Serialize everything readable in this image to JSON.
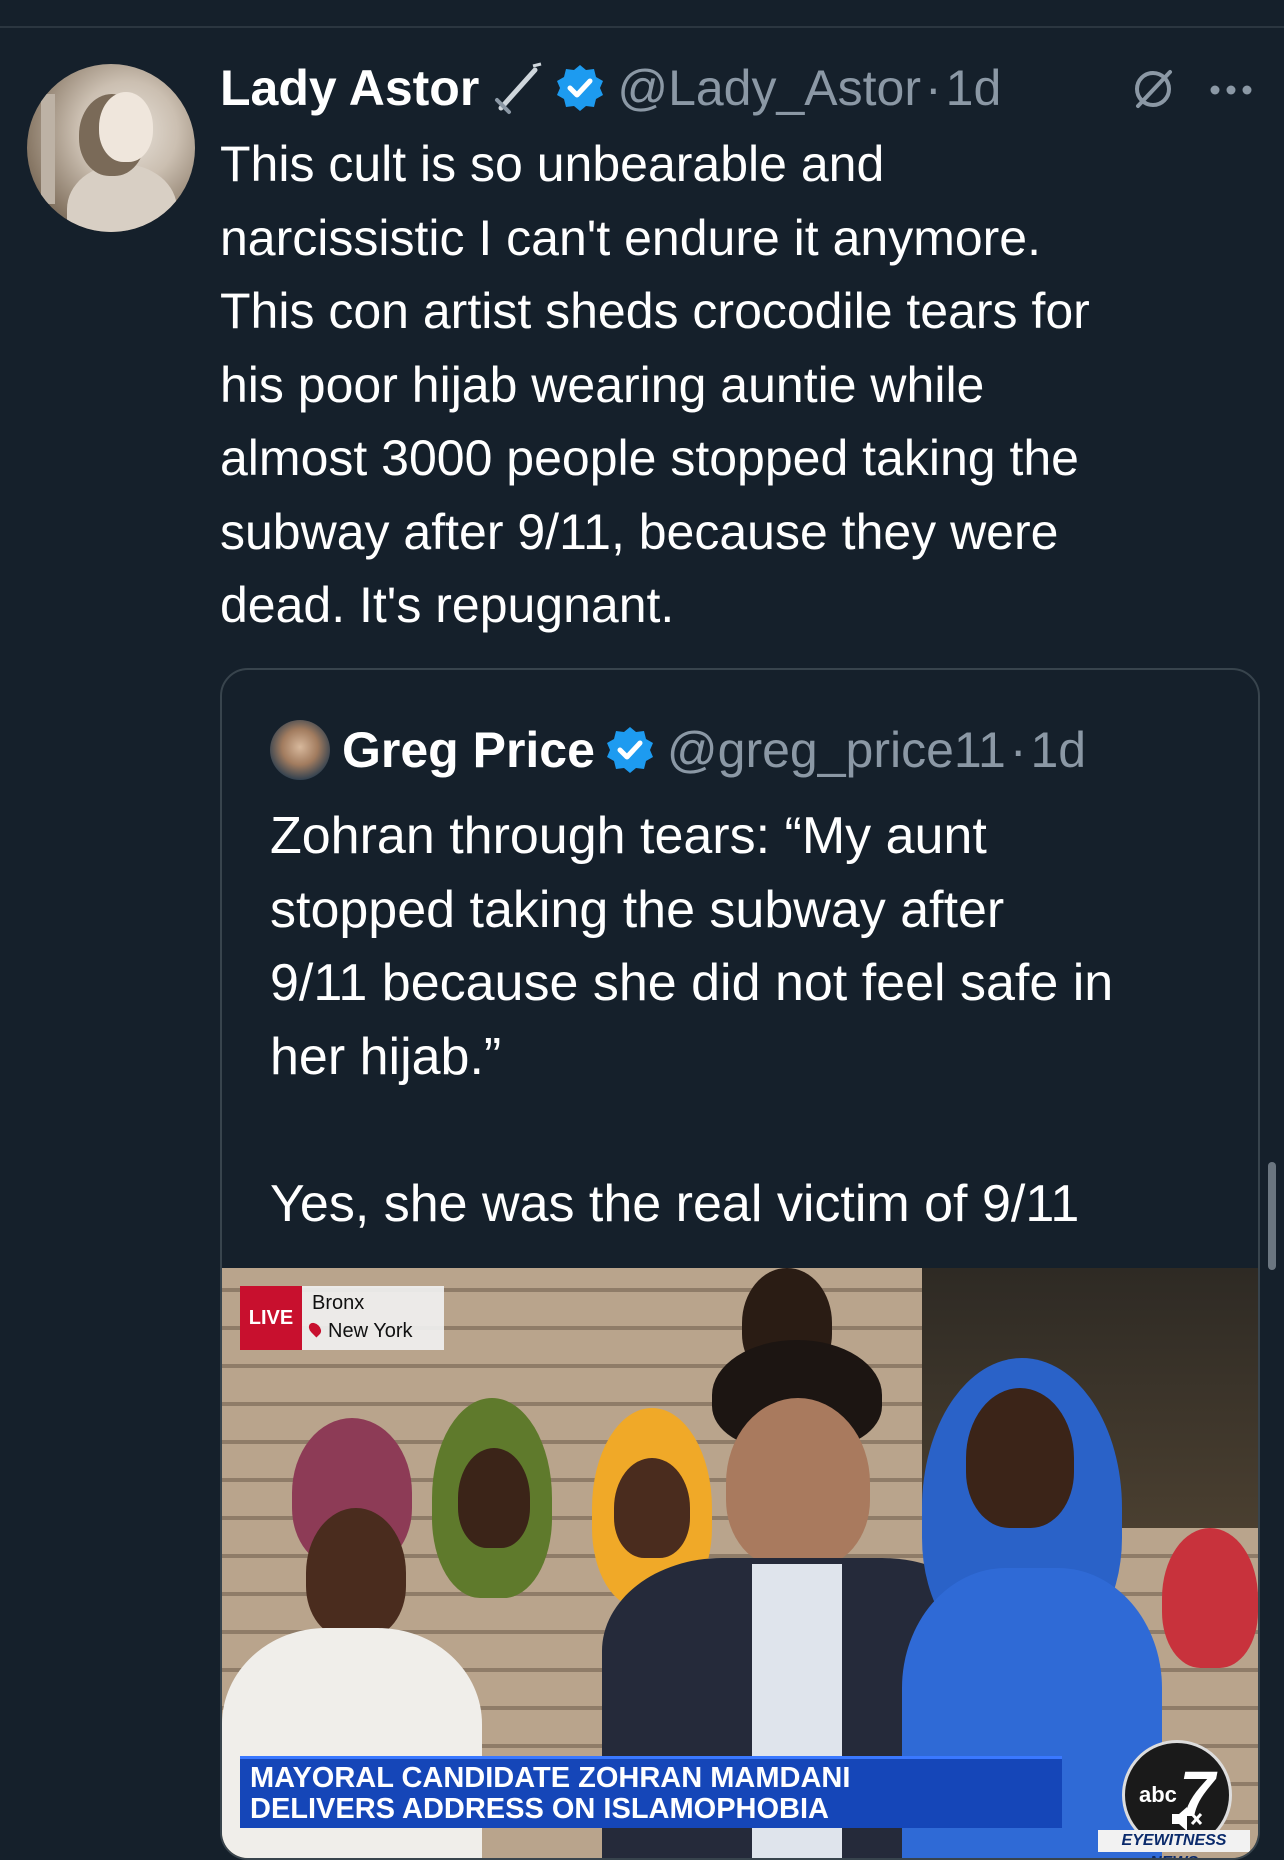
{
  "tweet": {
    "author_name": "Lady Astor",
    "author_handle": "@Lady_Astor",
    "separator": "·",
    "time": "1d",
    "text_lines": [
      "This cult is so unbearable and",
      "narcissistic I can't endure it anymore.",
      "This con artist sheds crocodile tears for",
      "his poor hijab wearing auntie while",
      "almost 3000 people stopped taking the",
      "subway after 9/11, because they were",
      "dead. It's repugnant."
    ],
    "icons": [
      "sword-icon",
      "verified-icon",
      "mute-icon",
      "more-icon"
    ]
  },
  "quote": {
    "author_name": "Greg Price",
    "author_handle": "@greg_price11",
    "separator": "·",
    "time": "1d",
    "text_lines": [
      "Zohran through tears: “My aunt",
      "stopped taking the subway after",
      "9/11 because she did not feel safe in",
      "her hijab.”",
      "",
      "Yes, she was the real victim of 9/11"
    ],
    "media": {
      "live_label": "LIVE",
      "location_city": "Bronx",
      "location_state": "New York",
      "headline_line1": "MAYORAL CANDIDATE ZOHRAN MAMDANI",
      "headline_line2": "DELIVERS ADDRESS ON ISLAMOPHOBIA",
      "station_logo_text": "abc",
      "station_number": "7",
      "station_tagline": "EYEWITNESS NEWS"
    }
  },
  "colors": {
    "background": "#15202b",
    "verified": "#1d9bf0",
    "secondary_text": "#8b98a5",
    "live_red": "#c8102e",
    "lower_third_blue": "#1546b8"
  }
}
